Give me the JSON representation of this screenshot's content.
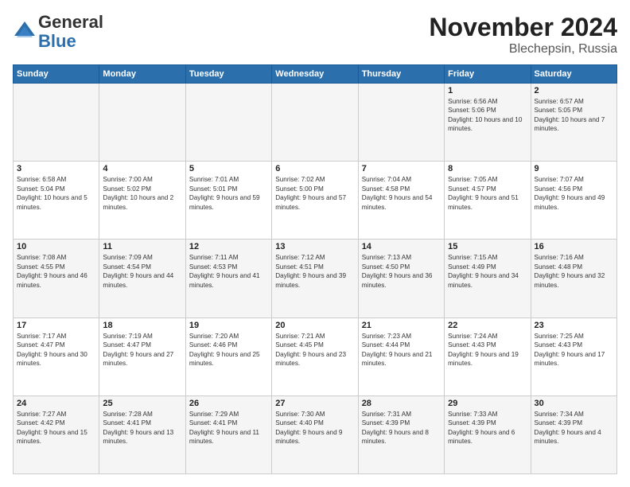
{
  "header": {
    "logo_general": "General",
    "logo_blue": "Blue",
    "month_title": "November 2024",
    "location": "Blechepsin, Russia"
  },
  "days_of_week": [
    "Sunday",
    "Monday",
    "Tuesday",
    "Wednesday",
    "Thursday",
    "Friday",
    "Saturday"
  ],
  "weeks": [
    [
      {
        "day": "",
        "info": ""
      },
      {
        "day": "",
        "info": ""
      },
      {
        "day": "",
        "info": ""
      },
      {
        "day": "",
        "info": ""
      },
      {
        "day": "",
        "info": ""
      },
      {
        "day": "1",
        "info": "Sunrise: 6:56 AM\nSunset: 5:06 PM\nDaylight: 10 hours and 10 minutes."
      },
      {
        "day": "2",
        "info": "Sunrise: 6:57 AM\nSunset: 5:05 PM\nDaylight: 10 hours and 7 minutes."
      }
    ],
    [
      {
        "day": "3",
        "info": "Sunrise: 6:58 AM\nSunset: 5:04 PM\nDaylight: 10 hours and 5 minutes."
      },
      {
        "day": "4",
        "info": "Sunrise: 7:00 AM\nSunset: 5:02 PM\nDaylight: 10 hours and 2 minutes."
      },
      {
        "day": "5",
        "info": "Sunrise: 7:01 AM\nSunset: 5:01 PM\nDaylight: 9 hours and 59 minutes."
      },
      {
        "day": "6",
        "info": "Sunrise: 7:02 AM\nSunset: 5:00 PM\nDaylight: 9 hours and 57 minutes."
      },
      {
        "day": "7",
        "info": "Sunrise: 7:04 AM\nSunset: 4:58 PM\nDaylight: 9 hours and 54 minutes."
      },
      {
        "day": "8",
        "info": "Sunrise: 7:05 AM\nSunset: 4:57 PM\nDaylight: 9 hours and 51 minutes."
      },
      {
        "day": "9",
        "info": "Sunrise: 7:07 AM\nSunset: 4:56 PM\nDaylight: 9 hours and 49 minutes."
      }
    ],
    [
      {
        "day": "10",
        "info": "Sunrise: 7:08 AM\nSunset: 4:55 PM\nDaylight: 9 hours and 46 minutes."
      },
      {
        "day": "11",
        "info": "Sunrise: 7:09 AM\nSunset: 4:54 PM\nDaylight: 9 hours and 44 minutes."
      },
      {
        "day": "12",
        "info": "Sunrise: 7:11 AM\nSunset: 4:53 PM\nDaylight: 9 hours and 41 minutes."
      },
      {
        "day": "13",
        "info": "Sunrise: 7:12 AM\nSunset: 4:51 PM\nDaylight: 9 hours and 39 minutes."
      },
      {
        "day": "14",
        "info": "Sunrise: 7:13 AM\nSunset: 4:50 PM\nDaylight: 9 hours and 36 minutes."
      },
      {
        "day": "15",
        "info": "Sunrise: 7:15 AM\nSunset: 4:49 PM\nDaylight: 9 hours and 34 minutes."
      },
      {
        "day": "16",
        "info": "Sunrise: 7:16 AM\nSunset: 4:48 PM\nDaylight: 9 hours and 32 minutes."
      }
    ],
    [
      {
        "day": "17",
        "info": "Sunrise: 7:17 AM\nSunset: 4:47 PM\nDaylight: 9 hours and 30 minutes."
      },
      {
        "day": "18",
        "info": "Sunrise: 7:19 AM\nSunset: 4:47 PM\nDaylight: 9 hours and 27 minutes."
      },
      {
        "day": "19",
        "info": "Sunrise: 7:20 AM\nSunset: 4:46 PM\nDaylight: 9 hours and 25 minutes."
      },
      {
        "day": "20",
        "info": "Sunrise: 7:21 AM\nSunset: 4:45 PM\nDaylight: 9 hours and 23 minutes."
      },
      {
        "day": "21",
        "info": "Sunrise: 7:23 AM\nSunset: 4:44 PM\nDaylight: 9 hours and 21 minutes."
      },
      {
        "day": "22",
        "info": "Sunrise: 7:24 AM\nSunset: 4:43 PM\nDaylight: 9 hours and 19 minutes."
      },
      {
        "day": "23",
        "info": "Sunrise: 7:25 AM\nSunset: 4:43 PM\nDaylight: 9 hours and 17 minutes."
      }
    ],
    [
      {
        "day": "24",
        "info": "Sunrise: 7:27 AM\nSunset: 4:42 PM\nDaylight: 9 hours and 15 minutes."
      },
      {
        "day": "25",
        "info": "Sunrise: 7:28 AM\nSunset: 4:41 PM\nDaylight: 9 hours and 13 minutes."
      },
      {
        "day": "26",
        "info": "Sunrise: 7:29 AM\nSunset: 4:41 PM\nDaylight: 9 hours and 11 minutes."
      },
      {
        "day": "27",
        "info": "Sunrise: 7:30 AM\nSunset: 4:40 PM\nDaylight: 9 hours and 9 minutes."
      },
      {
        "day": "28",
        "info": "Sunrise: 7:31 AM\nSunset: 4:39 PM\nDaylight: 9 hours and 8 minutes."
      },
      {
        "day": "29",
        "info": "Sunrise: 7:33 AM\nSunset: 4:39 PM\nDaylight: 9 hours and 6 minutes."
      },
      {
        "day": "30",
        "info": "Sunrise: 7:34 AM\nSunset: 4:39 PM\nDaylight: 9 hours and 4 minutes."
      }
    ]
  ]
}
